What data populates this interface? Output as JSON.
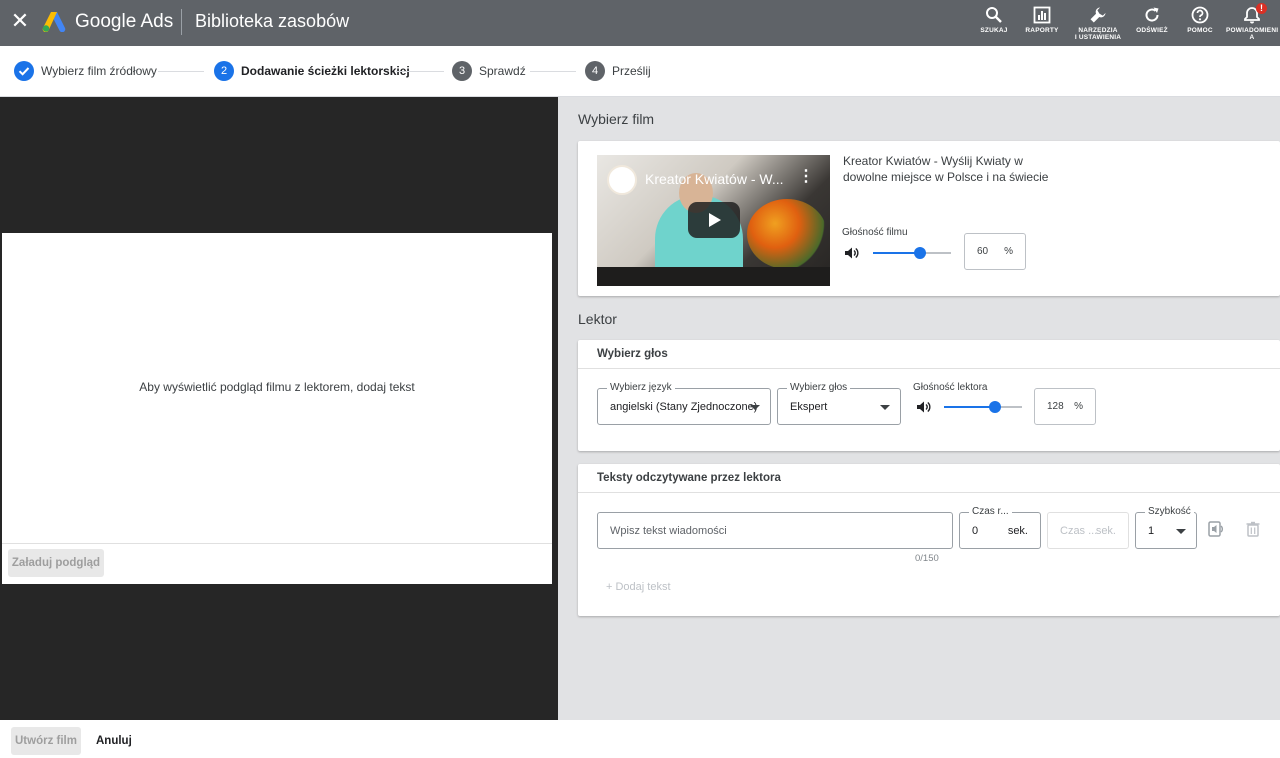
{
  "topbar": {
    "brand": "Google Ads",
    "section": "Biblioteka zasobów",
    "close_icon": "close-icon",
    "buttons": [
      {
        "label": "SZUKAJ",
        "icon": "search-icon"
      },
      {
        "label": "RAPORTY",
        "icon": "reports-icon"
      },
      {
        "label": "NARZĘDZIA\nI USTAWIENIA",
        "icon": "wrench-icon"
      },
      {
        "label": "ODŚWIEŻ",
        "icon": "refresh-icon"
      },
      {
        "label": "POMOC",
        "icon": "help-icon"
      },
      {
        "label": "POWIADOMIENI\nA",
        "icon": "bell-icon",
        "badge": "!"
      }
    ]
  },
  "stepper": {
    "steps": [
      {
        "num": "",
        "label": "Wybierz film źródłowy",
        "state": "done"
      },
      {
        "num": "2",
        "label": "Dodawanie ścieżki lektorskiej",
        "state": "active"
      },
      {
        "num": "3",
        "label": "Sprawdź",
        "state": "todo"
      },
      {
        "num": "4",
        "label": "Prześlij",
        "state": "todo"
      }
    ]
  },
  "preview": {
    "message": "Aby wyświetlić podgląd filmu z lektorem, dodaj tekst",
    "load_button": "Załaduj podgląd"
  },
  "film": {
    "heading": "Wybierz film",
    "thumb_title": "Kreator Kwiatów - W...",
    "name": "Kreator Kwiatów - Wyślij Kwiaty w dowolne miejsce w Polsce i na świecie",
    "volume_label": "Głośność filmu",
    "volume_value": "60",
    "volume_unit": "%",
    "volume_fraction": 0.6
  },
  "lektor": {
    "heading": "Lektor",
    "voice_card": {
      "title": "Wybierz głos",
      "language_label": "Wybierz język",
      "language_value": "angielski (Stany Zjednoczone)",
      "voice_label": "Wybierz głos",
      "voice_value": "Ekspert",
      "volume_label": "Głośność lektora",
      "volume_value": "128",
      "volume_unit": "%",
      "volume_fraction": 0.66
    },
    "texts_card": {
      "title": "Teksty odczytywane przez lektora",
      "message_placeholder": "Wpisz tekst wiadomości",
      "counter": "0/150",
      "start_label": "Czas r...",
      "start_value": "0",
      "start_unit": "sek.",
      "end_placeholder": "Czas ...",
      "end_unit": "sek.",
      "speed_label": "Szybkość",
      "speed_value": "1",
      "add_text": "+ Dodaj tekst"
    }
  },
  "footer": {
    "create_button": "Utwórz film",
    "cancel_button": "Anuluj"
  }
}
